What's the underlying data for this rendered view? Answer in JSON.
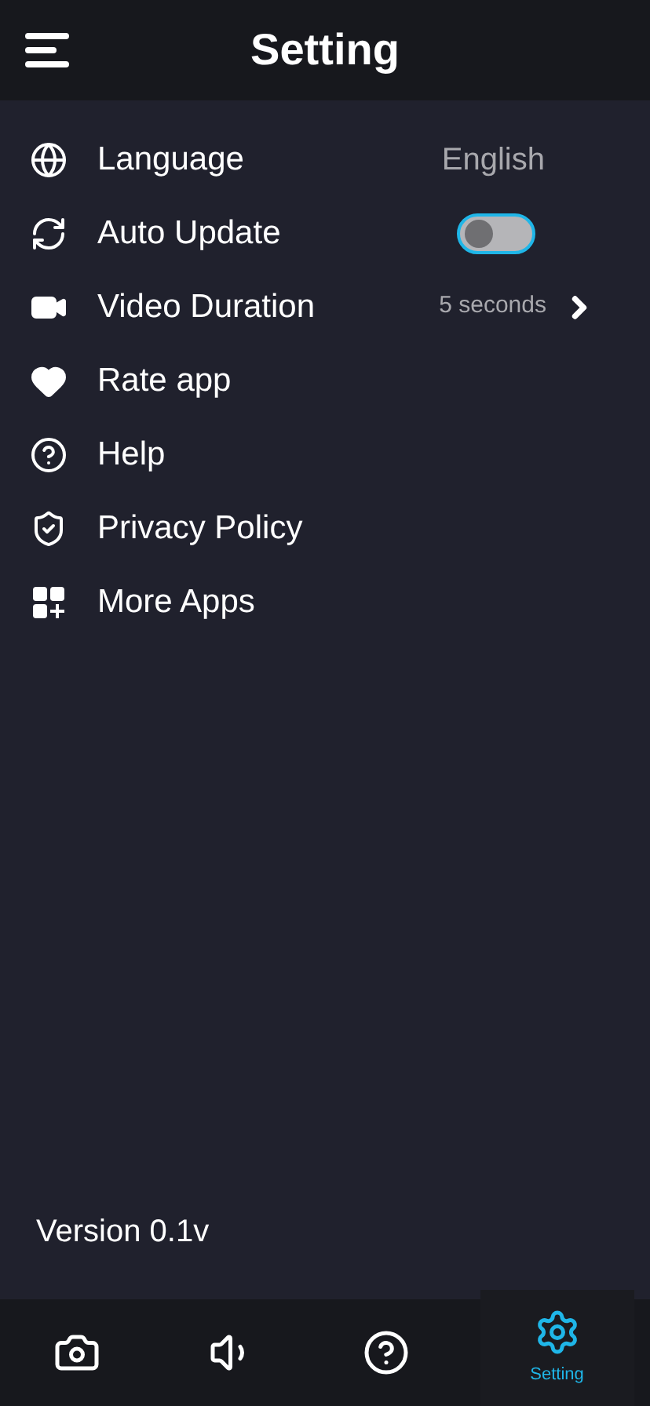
{
  "header": {
    "title": "Setting"
  },
  "settings": [
    {
      "kind": "value",
      "label": "Language",
      "value": "English"
    },
    {
      "kind": "toggle",
      "label": "Auto Update",
      "on": false
    },
    {
      "kind": "select",
      "label": "Video Duration",
      "value": "5 seconds"
    },
    {
      "kind": "plain",
      "label": "Rate app"
    },
    {
      "kind": "plain",
      "label": "Help"
    },
    {
      "kind": "plain",
      "label": "Privacy Policy"
    },
    {
      "kind": "plain",
      "label": "More Apps"
    }
  ],
  "version": "Version 0.1v",
  "nav": [
    {
      "selected": false
    },
    {
      "selected": false
    },
    {
      "selected": false
    },
    {
      "label": "Setting",
      "selected": true
    }
  ]
}
